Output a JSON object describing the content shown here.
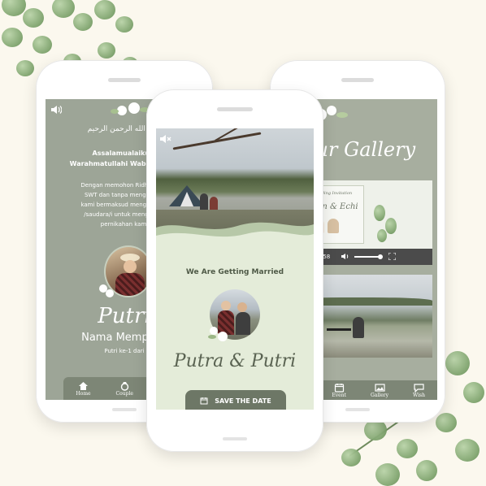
{
  "left_screen": {
    "arabic_basmala": "بسم الله الرحمن الرحيم",
    "greeting": "Assalamualaikum Warahmatullahi Wabarakatuh",
    "intro_lines": [
      "Dengan memohon Ridho serta",
      "SWT dan tanpa mengurangi",
      "kami bermaksud mengundang",
      "/saudara/i untuk menghadiri",
      "pernikahan kami"
    ],
    "bride_name_script": "Putri",
    "bride_full_name": "Nama Mempelai",
    "bride_order": "Putri ke-1 dari"
  },
  "center_screen": {
    "tagline": "We Are Getting Married",
    "couple_names": "Putra & Putri",
    "save_button": "SAVE THE DATE"
  },
  "right_screen": {
    "gallery_title": "Our Gallery",
    "video_card_caption": "Wedding Invitation",
    "video_card_names": "Ryan & Echi",
    "video_time": "0:00 / 0:58"
  },
  "nav": {
    "items": [
      {
        "label": "Home",
        "icon": "home-icon"
      },
      {
        "label": "Couple",
        "icon": "ring-icon"
      },
      {
        "label": "Event",
        "icon": "calendar-icon"
      },
      {
        "label": "Gallery",
        "icon": "gallery-icon"
      },
      {
        "label": "Wish",
        "icon": "chat-icon"
      }
    ]
  },
  "colors": {
    "background": "#fbf8ee",
    "sage": "#9da597",
    "mint": "#e4ecd9",
    "nav": "#7d8676"
  }
}
